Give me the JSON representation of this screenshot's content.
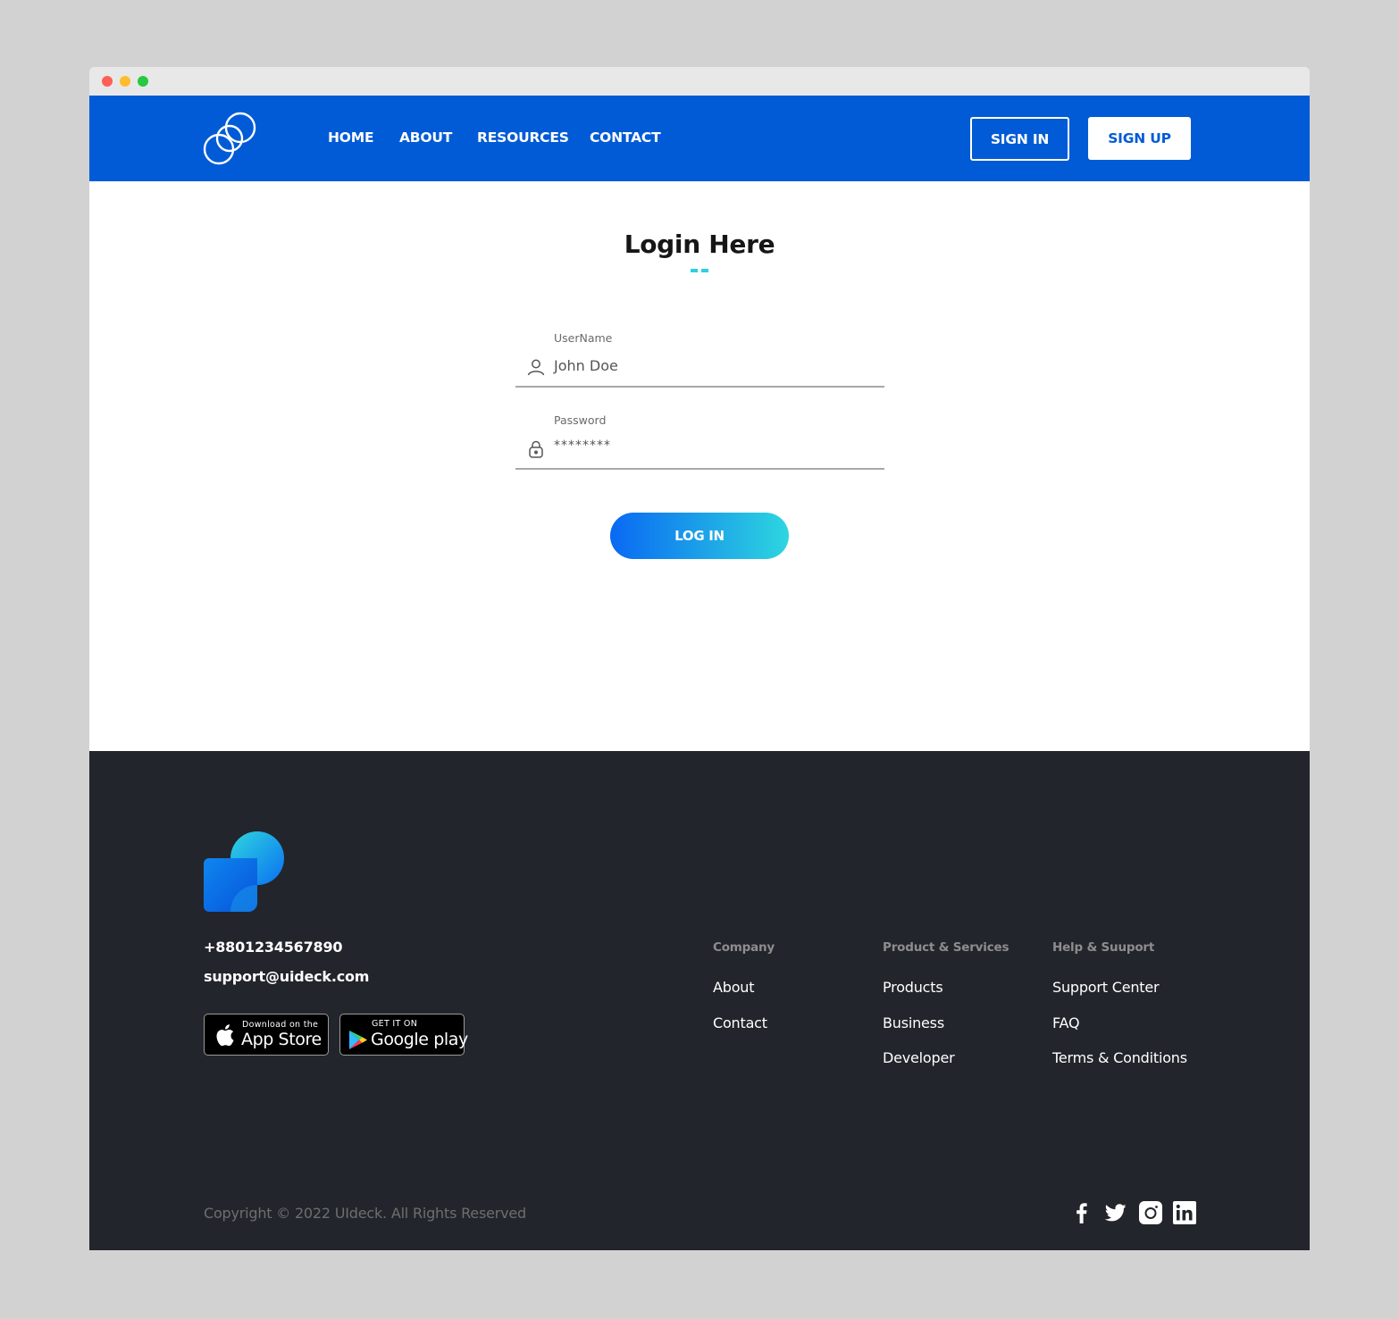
{
  "nav": {
    "links": [
      "HOME",
      "ABOUT",
      "RESOURCES",
      "CONTACT"
    ],
    "sign_in": "SIGN IN",
    "sign_up": "SIGN UP"
  },
  "login": {
    "title": "Login Here",
    "username_label": "UserName",
    "username_value": "John Doe",
    "password_label": "Password",
    "password_value": "********",
    "button": "LOG IN"
  },
  "footer": {
    "phone": "+8801234567890",
    "email": "support@uideck.com",
    "app_store_small": "Download on the",
    "app_store_big": "App Store",
    "google_small": "GET IT ON",
    "google_big": "Google play",
    "columns": [
      {
        "heading": "Company",
        "links": [
          "About",
          "Contact"
        ]
      },
      {
        "heading": "Product & Services",
        "links": [
          "Products",
          "Business",
          "Developer"
        ]
      },
      {
        "heading": "Help & Suuport",
        "links": [
          "Support Center",
          "FAQ",
          "Terms & Conditions"
        ]
      }
    ],
    "copyright": "Copyright © 2022 UIdeck. All Rights Reserved",
    "social_icons": [
      "facebook-icon",
      "twitter-icon",
      "instagram-icon",
      "linkedin-icon"
    ]
  },
  "colors": {
    "primary": "#025bd6",
    "accent": "#2dd0df",
    "footer_bg": "#22252b"
  }
}
